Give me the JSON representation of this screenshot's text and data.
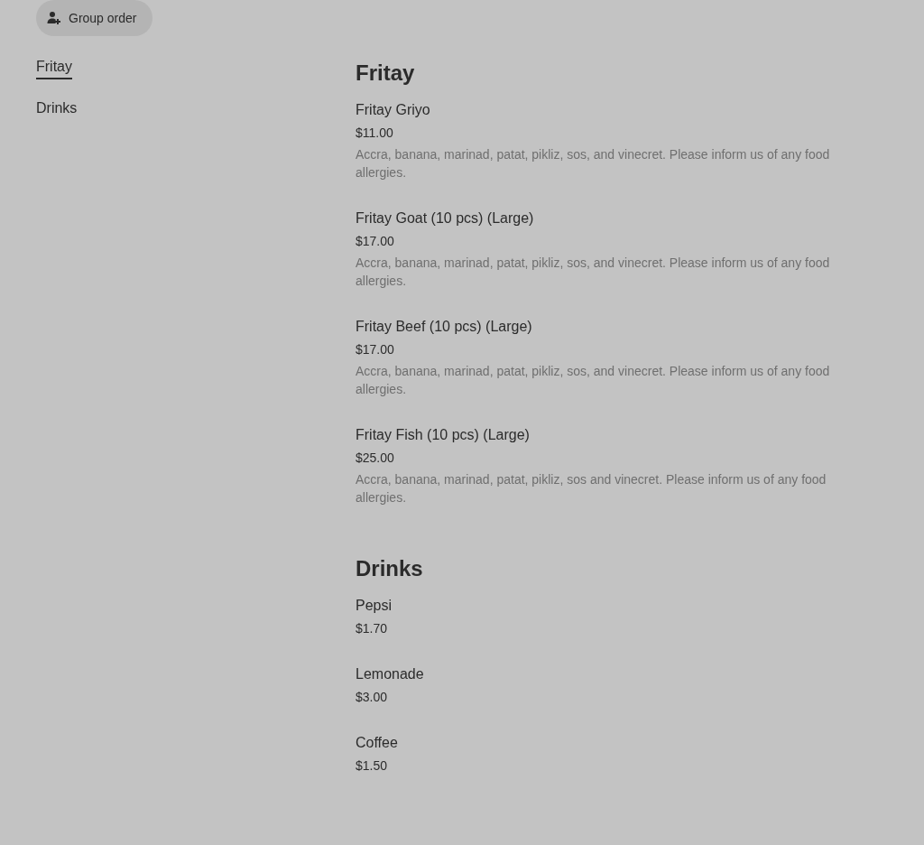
{
  "group_order_button": {
    "label": "Group order"
  },
  "sidebar": {
    "items": [
      {
        "label": "Fritay",
        "selected": true
      },
      {
        "label": "Drinks",
        "selected": false
      }
    ]
  },
  "sections": [
    {
      "title": "Fritay",
      "items": [
        {
          "name": "Fritay Griyo",
          "price": "$11.00",
          "description": "Accra, banana, marinad, patat, pikliz, sos, and vinecret. Please inform us of any food allergies."
        },
        {
          "name": "Fritay Goat (10 pcs) (Large)",
          "price": "$17.00",
          "description": "Accra, banana, marinad, patat, pikliz, sos, and vinecret. Please inform us of any food allergies."
        },
        {
          "name": "Fritay Beef (10 pcs) (Large)",
          "price": "$17.00",
          "description": "Accra, banana, marinad, patat, pikliz, sos, and vinecret. Please inform us of any food allergies."
        },
        {
          "name": "Fritay Fish (10 pcs) (Large)",
          "price": "$25.00",
          "description": "Accra, banana, marinad, patat, pikliz, sos and vinecret. Please inform us of any food allergies."
        }
      ]
    },
    {
      "title": "Drinks",
      "items": [
        {
          "name": "Pepsi",
          "price": "$1.70"
        },
        {
          "name": "Lemonade",
          "price": "$3.00"
        },
        {
          "name": "Coffee",
          "price": "$1.50"
        }
      ]
    }
  ]
}
